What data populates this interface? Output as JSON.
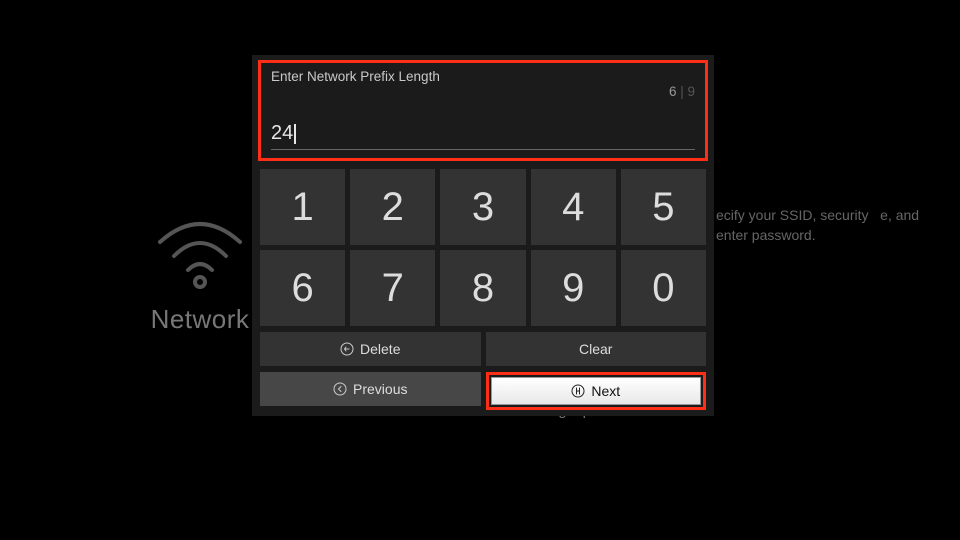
{
  "background": {
    "section_label": "Network",
    "hint_text": "ecify your SSID, security   e, and enter password.",
    "footer_link": "Basic Wi-Fi Troubleshooting Tips"
  },
  "modal": {
    "title": "Enter Network Prefix Length",
    "step_current": "6",
    "step_total": "9",
    "input_value": "24",
    "keys": [
      "1",
      "2",
      "3",
      "4",
      "5",
      "6",
      "7",
      "8",
      "9",
      "0"
    ],
    "delete_label": "Delete",
    "clear_label": "Clear",
    "previous_label": "Previous",
    "next_label": "Next"
  }
}
